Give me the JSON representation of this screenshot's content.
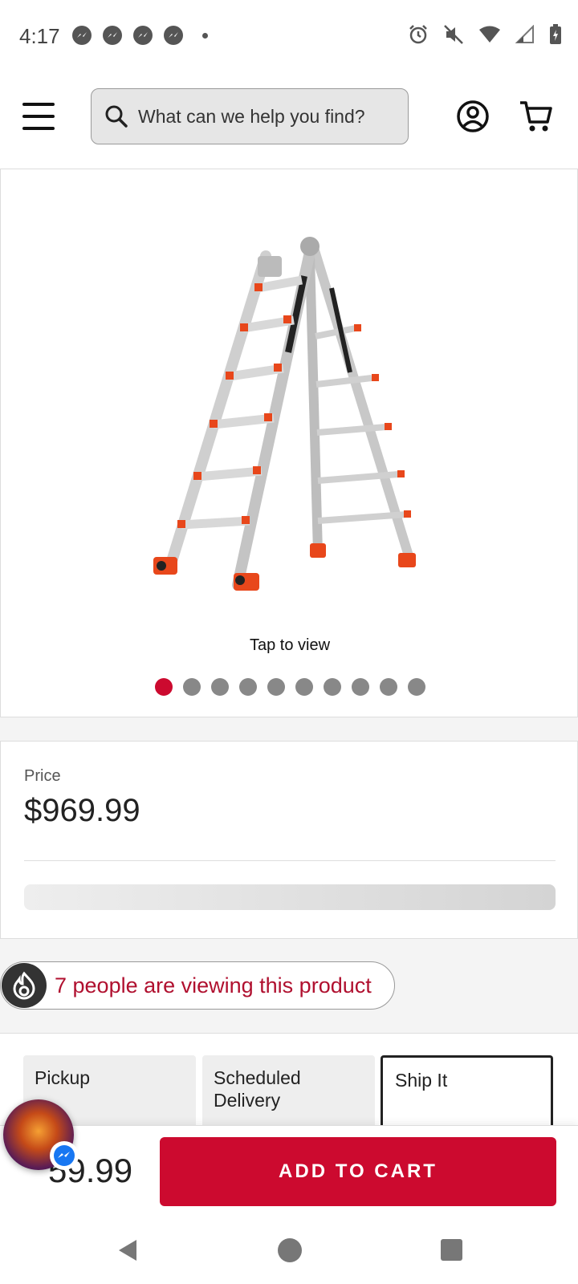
{
  "status_bar": {
    "time": "4:17",
    "notification_icons": [
      "messenger-icon",
      "messenger-icon",
      "messenger-icon",
      "messenger-icon"
    ],
    "system_icons": [
      "alarm-icon",
      "mute-icon",
      "wifi-icon",
      "signal-icon",
      "battery-icon"
    ]
  },
  "header": {
    "search_placeholder": "What can we help you find?"
  },
  "gallery": {
    "tap_label": "Tap to view",
    "image_count": 10,
    "active_index": 0
  },
  "price_section": {
    "label": "Price",
    "value": "$969.99"
  },
  "viewers": {
    "text": "7 people are viewing this product"
  },
  "fulfillment": {
    "options": [
      {
        "label": "Pickup",
        "selected": false
      },
      {
        "label": "Scheduled Delivery",
        "selected": false
      },
      {
        "label": "Ship It",
        "selected": true
      }
    ]
  },
  "bottom_bar": {
    "price_partial": "59.99",
    "add_to_cart": "ADD TO CART"
  },
  "colors": {
    "brand_red": "#cc0a2f",
    "viewers_red": "#b0102f"
  }
}
